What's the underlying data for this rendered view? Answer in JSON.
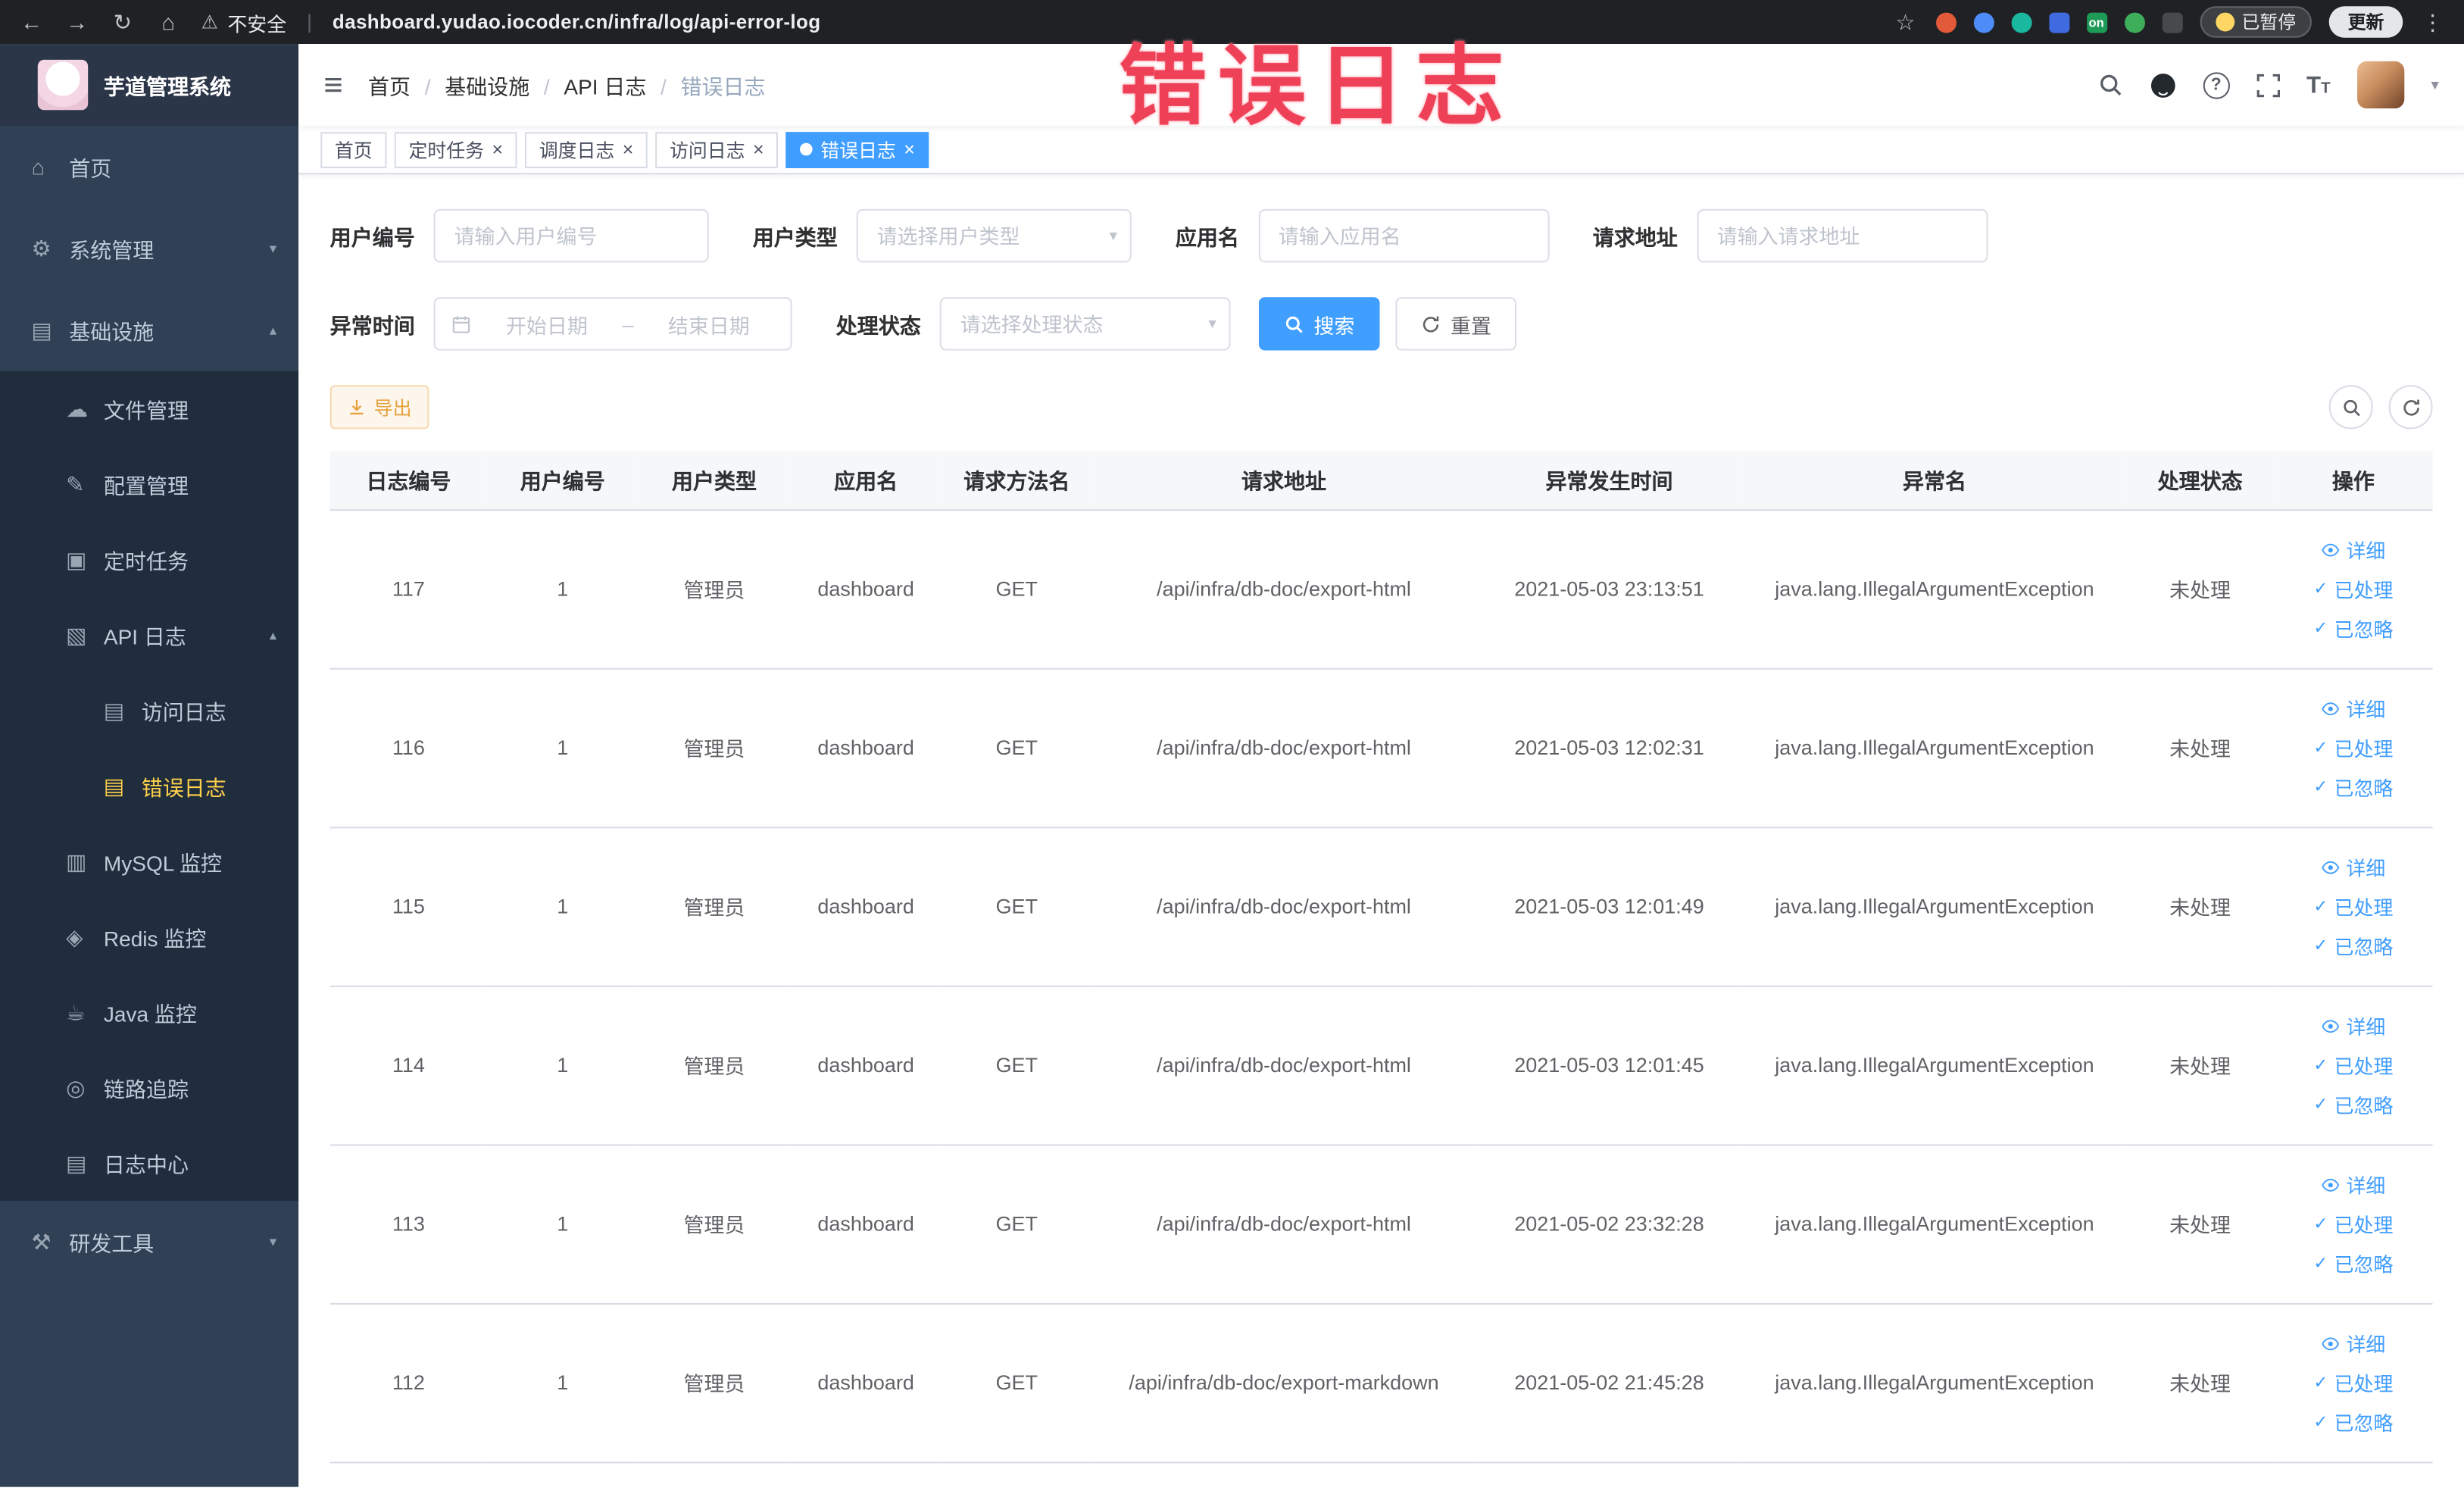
{
  "colors": {
    "primary": "#409eff",
    "sidebar_active": "#ffd04b",
    "annotation_red": "#ee4056",
    "warning_text": "#e6a23c"
  },
  "annotation": {
    "text": "错误日志"
  },
  "browser": {
    "security_label": "不安全",
    "url": "dashboard.yudao.iocoder.cn/infra/log/api-error-log",
    "extension_on_badge": "on",
    "paused_badge": "已暂停",
    "update_button": "更新"
  },
  "icons": {
    "back": "←",
    "forward": "→",
    "reload": "↻",
    "home": "⌂",
    "warning": "⚠",
    "star": "☆",
    "kebab": "⋮",
    "pipe": "|",
    "menu": "≡",
    "caret_down": "▾",
    "chevron_down": "▾",
    "chevron_up": "▴",
    "close": "×",
    "check": "✓",
    "question": "?",
    "font_large": "T",
    "font_small": "T",
    "sidebar_home": "⌂",
    "gear": "⚙",
    "infra": "▤",
    "cloud": "☁",
    "edit": "✎",
    "cron": "▣",
    "api": "▧",
    "doc": "▤",
    "db": "▥",
    "redis": "◈",
    "java": "☕",
    "trace": "◎",
    "tools": "⚒"
  },
  "sidebar": {
    "logo_title": "芋道管理系统",
    "items": [
      {
        "label": "首页"
      },
      {
        "label": "系统管理"
      },
      {
        "label": "基础设施"
      },
      {
        "label": "文件管理"
      },
      {
        "label": "配置管理"
      },
      {
        "label": "定时任务"
      },
      {
        "label": "API 日志"
      },
      {
        "label": "访问日志"
      },
      {
        "label": "错误日志"
      },
      {
        "label": "MySQL 监控"
      },
      {
        "label": "Redis 监控"
      },
      {
        "label": "Java 监控"
      },
      {
        "label": "链路追踪"
      },
      {
        "label": "日志中心"
      },
      {
        "label": "研发工具"
      }
    ]
  },
  "header": {
    "breadcrumb": [
      "首页",
      "基础设施",
      "API 日志",
      "错误日志"
    ]
  },
  "tabs": [
    {
      "label": "首页"
    },
    {
      "label": "定时任务"
    },
    {
      "label": "调度日志"
    },
    {
      "label": "访问日志"
    },
    {
      "label": "错误日志"
    }
  ],
  "filters": {
    "user_id_label": "用户编号",
    "user_id_placeholder": "请输入用户编号",
    "user_type_label": "用户类型",
    "user_type_placeholder": "请选择用户类型",
    "app_name_label": "应用名",
    "app_name_placeholder": "请输入应用名",
    "request_url_label": "请求地址",
    "request_url_placeholder": "请输入请求地址",
    "exception_time_label": "异常时间",
    "start_date_placeholder": "开始日期",
    "date_separator": "–",
    "end_date_placeholder": "结束日期",
    "process_status_label": "处理状态",
    "process_status_placeholder": "请选择处理状态",
    "search_button": "搜索",
    "reset_button": "重置"
  },
  "toolbar": {
    "export_button": "导出"
  },
  "table": {
    "columns": [
      "日志编号",
      "用户编号",
      "用户类型",
      "应用名",
      "请求方法名",
      "请求地址",
      "异常发生时间",
      "异常名",
      "处理状态",
      "操作"
    ],
    "actions": {
      "detail": "详细",
      "processed": "已处理",
      "ignored": "已忽略"
    },
    "rows": [
      {
        "id": "117",
        "user_id": "1",
        "user_type": "管理员",
        "app": "dashboard",
        "method": "GET",
        "url": "/api/infra/db-doc/export-html",
        "time": "2021-05-03 23:13:51",
        "exception": "java.lang.IllegalArgumentException",
        "status": "未处理"
      },
      {
        "id": "116",
        "user_id": "1",
        "user_type": "管理员",
        "app": "dashboard",
        "method": "GET",
        "url": "/api/infra/db-doc/export-html",
        "time": "2021-05-03 12:02:31",
        "exception": "java.lang.IllegalArgumentException",
        "status": "未处理"
      },
      {
        "id": "115",
        "user_id": "1",
        "user_type": "管理员",
        "app": "dashboard",
        "method": "GET",
        "url": "/api/infra/db-doc/export-html",
        "time": "2021-05-03 12:01:49",
        "exception": "java.lang.IllegalArgumentException",
        "status": "未处理"
      },
      {
        "id": "114",
        "user_id": "1",
        "user_type": "管理员",
        "app": "dashboard",
        "method": "GET",
        "url": "/api/infra/db-doc/export-html",
        "time": "2021-05-03 12:01:45",
        "exception": "java.lang.IllegalArgumentException",
        "status": "未处理"
      },
      {
        "id": "113",
        "user_id": "1",
        "user_type": "管理员",
        "app": "dashboard",
        "method": "GET",
        "url": "/api/infra/db-doc/export-html",
        "time": "2021-05-02 23:32:28",
        "exception": "java.lang.IllegalArgumentException",
        "status": "未处理"
      },
      {
        "id": "112",
        "user_id": "1",
        "user_type": "管理员",
        "app": "dashboard",
        "method": "GET",
        "url": "/api/infra/db-doc/export-markdown",
        "time": "2021-05-02 21:45:28",
        "exception": "java.lang.IllegalArgumentException",
        "status": "未处理"
      }
    ]
  }
}
